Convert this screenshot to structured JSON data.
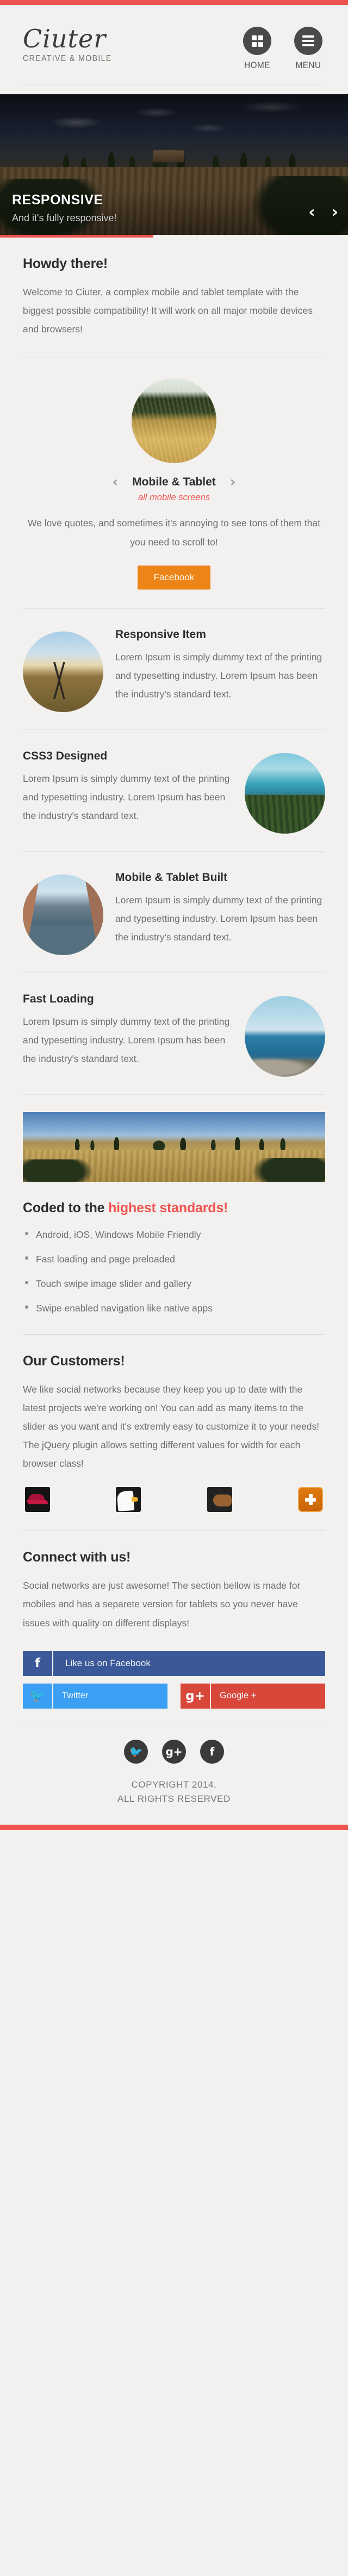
{
  "header": {
    "brand_name": "Ciuter",
    "brand_tagline": "CREATIVE & MOBILE",
    "nav": [
      {
        "label": "HOME",
        "icon": "grid-icon"
      },
      {
        "label": "MENU",
        "icon": "hamburger-icon"
      }
    ]
  },
  "hero": {
    "title": "RESPONSIVE",
    "subtitle": "And it's fully responsive!",
    "prev_arrow": "‹",
    "next_arrow": "›",
    "progress_percent": 44
  },
  "intro": {
    "heading": "Howdy there!",
    "text": "Welcome to Ciuter, a complex mobile and tablet template with the biggest possible compatibility! It will work on all major mobile devices and browsers!"
  },
  "quote": {
    "prev_arrow": "‹",
    "next_arrow": "›",
    "name": "Mobile & Tablet",
    "role": "all mobile screens",
    "text": "We love quotes, and sometimes it's annoying to see tons of them that you need to scroll to!",
    "button_label": "Facebook"
  },
  "features": [
    {
      "title": "Responsive Item",
      "text": "Lorem Ipsum is simply dummy text of the printing and typesetting industry. Lorem Ipsum has been the industry's standard text.",
      "image_position": "left"
    },
    {
      "title": "CSS3 Designed",
      "text": "Lorem Ipsum is simply dummy text of the printing and typesetting industry. Lorem Ipsum has been the industry's standard text.",
      "image_position": "right"
    },
    {
      "title": "Mobile & Tablet Built",
      "text": "Lorem Ipsum is simply dummy text of the printing and typesetting industry. Lorem Ipsum has been the industry's standard text.",
      "image_position": "left"
    },
    {
      "title": "Fast Loading",
      "text": "Lorem Ipsum is simply dummy text of the printing and typesetting industry. Lorem Ipsum has been the industry's standard text.",
      "image_position": "right"
    }
  ],
  "standards": {
    "heading_plain": "Coded to the ",
    "heading_accent": "highest standards!",
    "bullets": [
      "Android, iOS, Windows Mobile Friendly",
      "Fast loading and page preloaded",
      "Touch swipe image slider and gallery",
      "Swipe enabled navigation like native apps"
    ]
  },
  "customers": {
    "heading": "Our Customers!",
    "text": "We like social networks because they keep you up to date with the latest projects we're working on! You can add as many items to the slider as you want and it's extremly easy to customize it to your needs! The jQuery plugin allows setting different values for width for each browser class!",
    "logos": [
      {
        "name": "red-hat-logo"
      },
      {
        "name": "eagle-logo"
      },
      {
        "name": "hand-logo"
      },
      {
        "name": "plus-logo"
      }
    ]
  },
  "connect": {
    "heading": "Connect with us!",
    "text": "Social networks are just awesome! The section bellow is made for mobiles and has a separete version for tablets so you never have issues with quality on different displays!",
    "buttons": [
      {
        "network": "facebook",
        "icon": "f",
        "label": "Like us on Facebook",
        "color": "#3b5998"
      },
      {
        "network": "twitter",
        "icon": "🐦",
        "label": "Twitter",
        "color": "#3ba0f4"
      },
      {
        "network": "googleplus",
        "icon": "g+",
        "label": "Google +",
        "color": "#d9463a"
      }
    ]
  },
  "footer": {
    "socials": [
      {
        "name": "twitter-icon",
        "glyph": "🐦"
      },
      {
        "name": "googleplus-icon",
        "glyph": "g+"
      },
      {
        "name": "facebook-icon",
        "glyph": "f"
      }
    ],
    "copyright_line1": "COPYRIGHT 2014.",
    "copyright_line2": "ALL RIGHTS RESERVED"
  },
  "colors": {
    "accent_red": "#ef5350",
    "accent_orange": "#ec8418",
    "facebook": "#3b5998",
    "twitter": "#3ba0f4",
    "googleplus": "#d9463a",
    "background": "#f2f1ef"
  }
}
